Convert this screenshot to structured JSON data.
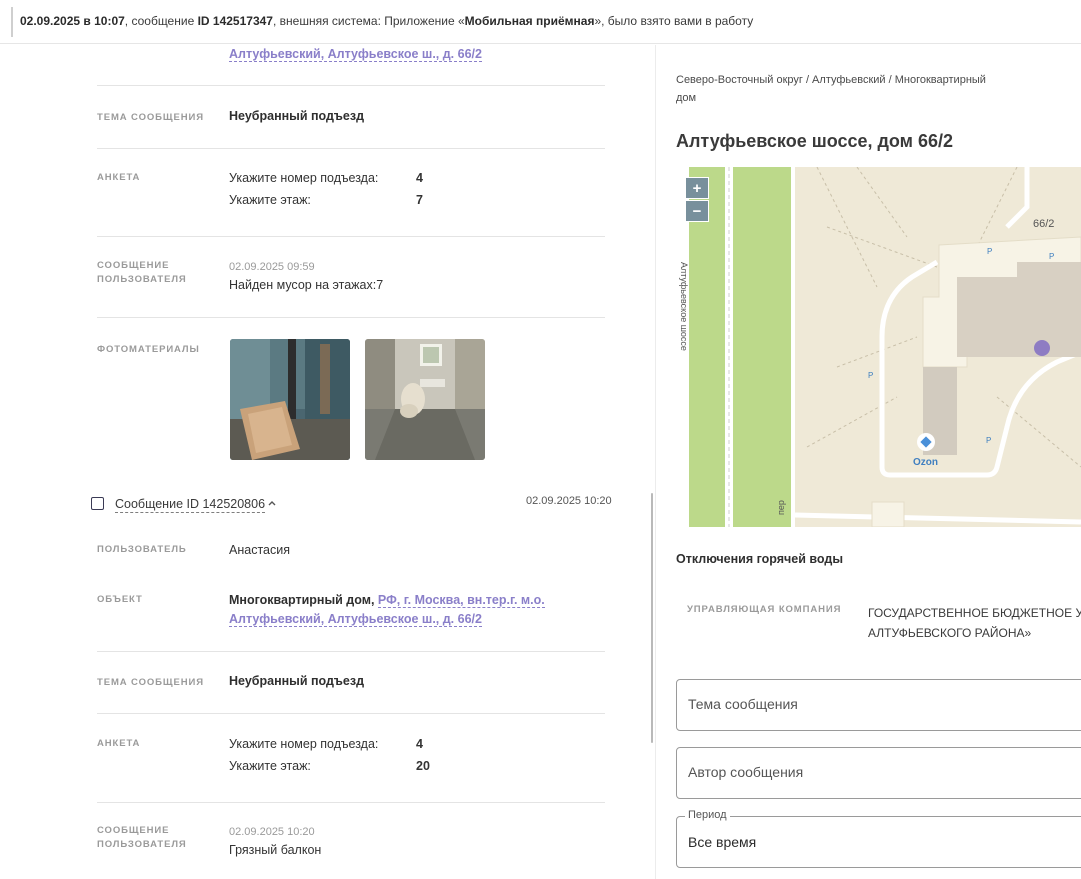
{
  "notification": {
    "datetime": "02.09.2025 в 10:07",
    "text_1": ", сообщение ",
    "msg_id": "ID 142517347",
    "text_2": ", внешняя система: Приложение «",
    "system": "Мобильная приёмная",
    "text_3": "», было взято вами в работу"
  },
  "feed": {
    "msg1": {
      "object_link_tail": "Алтуфьевский, Алтуфьевское ш., д. 66/2",
      "topic_label": "ТЕМА СООБЩЕНИЯ",
      "topic": "Неубранный подъезд",
      "survey_label": "АНКЕТА",
      "survey": [
        {
          "q": "Укажите номер подъезда:",
          "a": "4"
        },
        {
          "q": "Укажите этаж:",
          "a": "7"
        }
      ],
      "user_msg_label_1": "СООБЩЕНИЕ",
      "user_msg_label_2": "ПОЛЬЗОВАТЕЛЯ",
      "user_msg_date": "02.09.2025 09:59",
      "user_msg_text": "Найден мусор на этажах:7",
      "photos_label": "ФОТОМАТЕРИАЛЫ"
    },
    "msg2": {
      "title": "Сообщение ID 142520806",
      "date": "02.09.2025 10:20",
      "user_label": "ПОЛЬЗОВАТЕЛЬ",
      "user": "Анастасия",
      "object_label": "ОБЪЕКТ",
      "object_type": "Многоквартирный дом, ",
      "object_link_1": "РФ, г. Москва, вн.тер.г. м.о.",
      "object_link_2": "Алтуфьевский, Алтуфьевское ш., д. 66/2",
      "topic_label": "ТЕМА СООБЩЕНИЯ",
      "topic": "Неубранный подъезд",
      "survey_label": "АНКЕТА",
      "survey": [
        {
          "q": "Укажите номер подъезда:",
          "a": "4"
        },
        {
          "q": "Укажите этаж:",
          "a": "20"
        }
      ],
      "user_msg_label_1": "СООБЩЕНИЕ",
      "user_msg_label_2": "ПОЛЬЗОВАТЕЛЯ",
      "user_msg_date": "02.09.2025 10:20",
      "user_msg_text": "Грязный балкон"
    }
  },
  "right": {
    "breadcrumb_1": "Северо-Восточный округ / Алтуфьевский / Многоквартирный",
    "breadcrumb_2": "дом",
    "address": "Алтуфьевское шоссе, дом 66/2",
    "map": {
      "zoom_in": "+",
      "zoom_out": "−",
      "house_number": "66/2",
      "poi": "Ozon",
      "street_fragment": "Алтуфьевское шоссе",
      "street_fragment_2": "пер",
      "parking": "P",
      "accent": "#8e7cc3"
    },
    "hot_water": "Отключения горячей воды",
    "mc_label": "УПРАВЛЯЮЩАЯ КОМПАНИЯ",
    "mc_value_1": "ГОСУДАРСТВЕННОЕ БЮДЖЕТНОЕ УЧ",
    "mc_value_2": "АЛТУФЬЕВСКОГО РАЙОНА»",
    "filter_topic_placeholder": "Тема сообщения",
    "filter_author_placeholder": "Автор сообщения",
    "period_label": "Период",
    "period_value": "Все время"
  }
}
